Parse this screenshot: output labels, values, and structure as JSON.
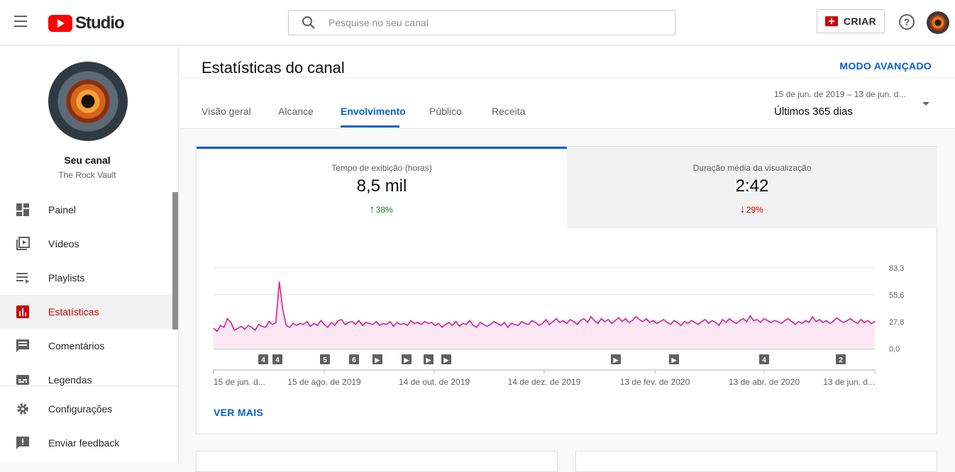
{
  "topbar": {
    "logo_text": "Studio",
    "search_placeholder": "Pesquise no seu canal",
    "create_label": "CRIAR",
    "help_glyph": "?"
  },
  "sidebar": {
    "channel_label": "Seu canal",
    "channel_name": "The Rock Vault",
    "items": [
      {
        "label": "Painel",
        "icon": "dashboard-icon"
      },
      {
        "label": "Vídeos",
        "icon": "videos-icon"
      },
      {
        "label": "Playlists",
        "icon": "playlists-icon"
      },
      {
        "label": "Estatísticas",
        "icon": "analytics-icon",
        "active": true
      },
      {
        "label": "Comentários",
        "icon": "comments-icon"
      },
      {
        "label": "Legendas",
        "icon": "subtitles-icon"
      }
    ],
    "bottom_items": [
      {
        "label": "Configurações",
        "icon": "gear-icon"
      },
      {
        "label": "Enviar feedback",
        "icon": "feedback-icon"
      }
    ]
  },
  "header": {
    "title": "Estatísticas do canal",
    "advanced_mode": "MODO AVANÇADO",
    "tabs": [
      "Visão geral",
      "Alcance",
      "Envolvimento",
      "Público",
      "Receita"
    ],
    "active_tab": "Envolvimento",
    "date_range_sub": "15 de jun. de 2019 – 13 de jun. d...",
    "date_range_main": "Últimos 365 dias"
  },
  "metrics": [
    {
      "label": "Tempo de exibição (horas)",
      "value": "8,5 mil",
      "change": "38%",
      "direction": "up"
    },
    {
      "label": "Duração média da visualização",
      "value": "2:42",
      "change": "29%",
      "direction": "down"
    }
  ],
  "ver_mais": "VER MAIS",
  "colors": {
    "accent": "#065fd4",
    "line": "#d81e9b",
    "fill": "#fde7f4",
    "up": "#107516",
    "down": "#cc0000",
    "active_nav": "#cc0000"
  },
  "chart_data": {
    "type": "area",
    "title": "",
    "xlabel": "",
    "ylabel": "",
    "ylim": [
      0,
      83.3
    ],
    "y_ticks": [
      "83,3",
      "55,6",
      "27,8",
      "0,0"
    ],
    "x_tick_labels": [
      "15 de jun. d...",
      "15 de ago. de 2019",
      "14 de out. de 2019",
      "14 de dez. de 2019",
      "13 de fev. de 2020",
      "13 de abr. de 2020",
      "13 de jun. d..."
    ],
    "markers": [
      "4",
      "4",
      "5",
      "6",
      "▶",
      "▶",
      "▶",
      "▶",
      "▶",
      "▶",
      "4",
      "2"
    ],
    "series": [
      {
        "values": [
          21,
          18,
          24,
          22,
          31,
          27,
          19,
          21,
          23,
          20,
          24,
          22,
          19,
          25,
          23,
          22,
          28,
          25,
          27,
          69,
          40,
          24,
          22,
          26,
          24,
          26,
          25,
          28,
          23,
          26,
          24,
          29,
          25,
          22,
          27,
          24,
          29,
          30,
          25,
          27,
          28,
          25,
          29,
          24,
          27,
          26,
          25,
          28,
          24,
          26,
          25,
          28,
          23,
          27,
          25,
          26,
          24,
          29,
          26,
          27,
          25,
          28,
          26,
          27,
          24,
          26,
          22,
          25,
          27,
          24,
          28,
          23,
          26,
          25,
          29,
          24,
          22,
          27,
          25,
          23,
          25,
          28,
          26,
          24,
          27,
          22,
          26,
          25,
          24,
          28,
          26,
          25,
          29,
          27,
          24,
          26,
          30,
          25,
          28,
          31,
          27,
          29,
          26,
          30,
          28,
          25,
          29,
          31,
          27,
          33,
          29,
          26,
          31,
          28,
          30,
          26,
          29,
          32,
          28,
          31,
          27,
          29,
          33,
          30,
          28,
          31,
          27,
          29,
          26,
          28,
          30,
          27,
          25,
          29,
          27,
          24,
          28,
          26,
          29,
          27,
          25,
          28,
          30,
          26,
          29,
          27,
          24,
          30,
          27,
          31,
          28,
          26,
          29,
          31,
          28,
          34,
          29,
          30,
          27,
          31,
          29,
          27,
          29,
          28,
          26,
          29,
          31,
          28,
          25,
          28,
          26,
          29,
          27,
          33,
          28,
          30,
          27,
          29,
          26,
          28,
          32,
          29,
          27,
          29,
          31,
          28,
          26,
          30,
          27,
          29,
          26,
          28
        ]
      }
    ]
  }
}
